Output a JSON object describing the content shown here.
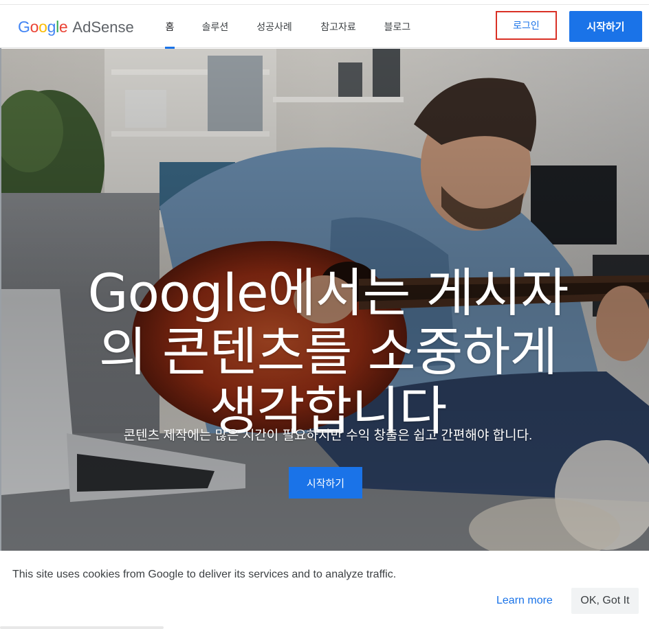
{
  "header": {
    "logo_google": [
      "G",
      "o",
      "o",
      "g",
      "l",
      "e"
    ],
    "logo_google_colors": [
      "#4285F4",
      "#EA4335",
      "#FBBC05",
      "#4285F4",
      "#34A853",
      "#EA4335"
    ],
    "logo_product": "AdSense",
    "nav": [
      {
        "label": "홈",
        "active": true
      },
      {
        "label": "솔루션",
        "active": false
      },
      {
        "label": "성공사례",
        "active": false
      },
      {
        "label": "참고자료",
        "active": false
      },
      {
        "label": "블로그",
        "active": false
      }
    ],
    "login_label": "로그인",
    "start_label": "시작하기"
  },
  "hero": {
    "title_line1": "Google에서는 게시자",
    "title_line2": "의 콘텐츠를 소중하게",
    "title_line3": "생각합니다",
    "subtitle": "콘텐츠 제작에는 많은 시간이 필요하지만 수익 창출은 쉽고 간편해야 합니다.",
    "cta_label": "시작하기"
  },
  "cookie": {
    "text": "This site uses cookies from Google to deliver its services and to analyze traffic.",
    "learn_more": "Learn more",
    "ok_label": "OK, Got It"
  },
  "colors": {
    "accent": "#1a73e8",
    "login_highlight": "#d93025"
  }
}
